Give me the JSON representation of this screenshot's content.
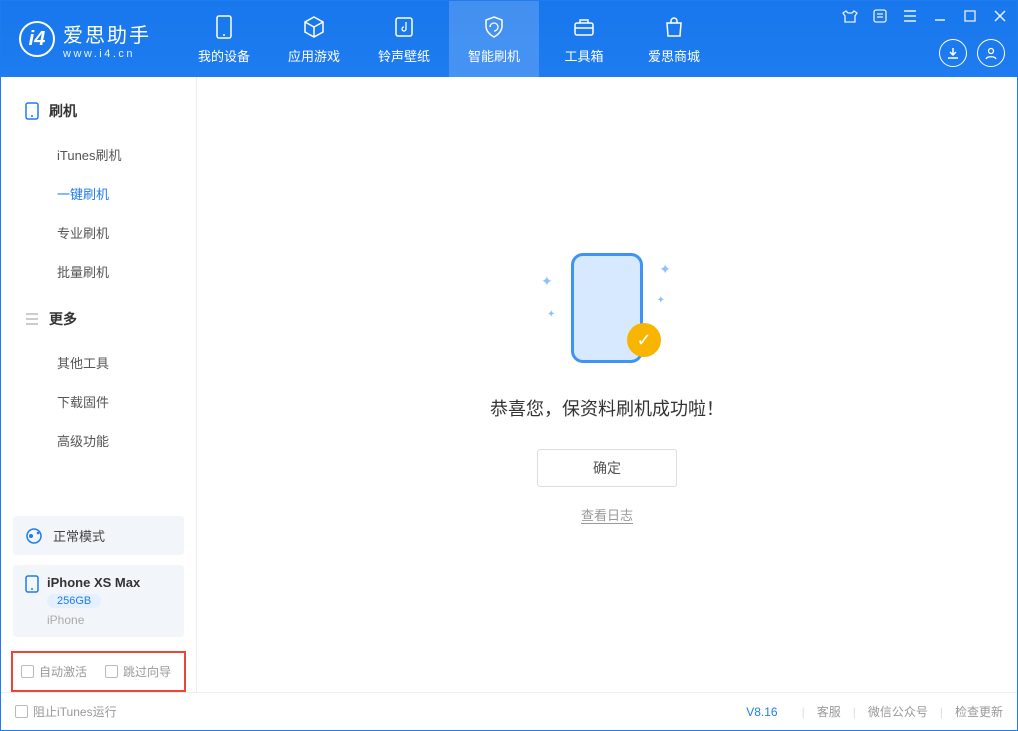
{
  "app": {
    "name_cn": "爱思助手",
    "url": "www.i4.cn"
  },
  "nav": {
    "device": "我的设备",
    "apps": "应用游戏",
    "ringtone": "铃声壁纸",
    "flash": "智能刷机",
    "toolbox": "工具箱",
    "store": "爱思商城"
  },
  "sidebar": {
    "flash_group": "刷机",
    "items": {
      "itunes": "iTunes刷机",
      "oneclick": "一键刷机",
      "pro": "专业刷机",
      "batch": "批量刷机"
    },
    "more_group": "更多",
    "more": {
      "other": "其他工具",
      "firmware": "下载固件",
      "advanced": "高级功能"
    }
  },
  "status": {
    "mode": "正常模式"
  },
  "device": {
    "name": "iPhone XS Max",
    "capacity": "256GB",
    "type": "iPhone"
  },
  "options": {
    "auto_activate": "自动激活",
    "skip_guide": "跳过向导"
  },
  "main": {
    "success_msg": "恭喜您，保资料刷机成功啦！",
    "ok": "确定",
    "view_log": "查看日志"
  },
  "statusbar": {
    "block_itunes": "阻止iTunes运行",
    "version": "V8.16",
    "support": "客服",
    "wechat": "微信公众号",
    "update": "检查更新"
  }
}
